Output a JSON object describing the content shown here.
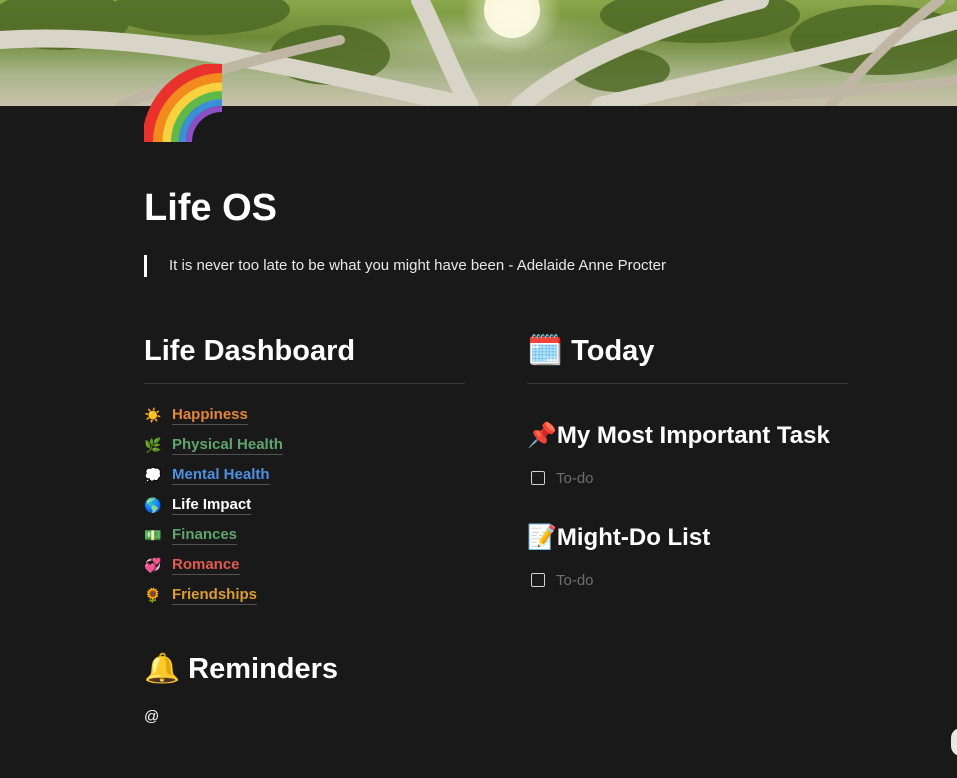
{
  "page": {
    "title": "Life OS",
    "quote": "It is never too late to be what you might have been - Adelaide Anne Procter",
    "icon": "rainbow-icon"
  },
  "dashboard": {
    "heading": "Life Dashboard",
    "items": [
      {
        "emoji": "☀️",
        "label": "Happiness",
        "color": "#e3843a",
        "icon": "sun-icon"
      },
      {
        "emoji": "🌿",
        "label": "Physical Health",
        "color": "#5fa46c",
        "icon": "herb-icon"
      },
      {
        "emoji": "💭",
        "label": "Mental Health",
        "color": "#4d8fe0",
        "icon": "thought-bubble-icon"
      },
      {
        "emoji": "🌎",
        "label": "Life Impact",
        "color": "#ffffff",
        "icon": "globe-icon"
      },
      {
        "emoji": "💵",
        "label": "Finances",
        "color": "#5fa46c",
        "icon": "money-icon"
      },
      {
        "emoji": "💞",
        "label": "Romance",
        "color": "#e05a52",
        "icon": "hearts-icon"
      },
      {
        "emoji": "🌻",
        "label": "Friendships",
        "color": "#dc9b33",
        "icon": "sunflower-icon"
      }
    ]
  },
  "reminders": {
    "emoji": "🔔",
    "heading": "Reminders",
    "mention": "@"
  },
  "today": {
    "emoji": "🗓️",
    "heading": "Today",
    "sections": [
      {
        "emoji": "📌",
        "heading": "My Most Important Task",
        "todo_placeholder": "To-do"
      },
      {
        "emoji": "📝",
        "heading": "Might-Do List",
        "todo_placeholder": "To-do"
      }
    ]
  }
}
